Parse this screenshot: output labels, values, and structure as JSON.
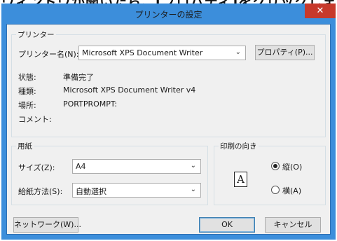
{
  "background_text": "ウィンドウが開いたら、[プロパティ]をクリックします",
  "dialog": {
    "title": "プリンターの設定",
    "close_glyph": "✕"
  },
  "printer_group": {
    "label": "プリンター",
    "name_label": "プリンター名(N):",
    "name_value": "Microsoft XPS Document Writer",
    "properties_button": "プロパティ(P)...",
    "status_label": "状態:",
    "status_value": "準備完了",
    "type_label": "種類:",
    "type_value": "Microsoft XPS Document Writer v4",
    "location_label": "場所:",
    "location_value": "PORTPROMPT:",
    "comment_label": "コメント:"
  },
  "paper_group": {
    "label": "用紙",
    "size_label": "サイズ(Z):",
    "size_value": "A4",
    "source_label": "給紙方法(S):",
    "source_value": "自動選択"
  },
  "orientation_group": {
    "label": "印刷の向き",
    "icon_letter": "A",
    "portrait_label": "縦(O)",
    "landscape_label": "横(A)",
    "selected": "portrait"
  },
  "footer": {
    "network_button": "ネットワーク(W)...",
    "ok_button": "OK",
    "cancel_button": "キャンセル"
  },
  "colors": {
    "frame": "#3c8edb",
    "close": "#c7392b",
    "client": "#f0f0f0"
  },
  "icons": {
    "dropdown": "chevron-down-icon",
    "close": "close-icon",
    "orientation": "portrait-orientation-icon"
  }
}
